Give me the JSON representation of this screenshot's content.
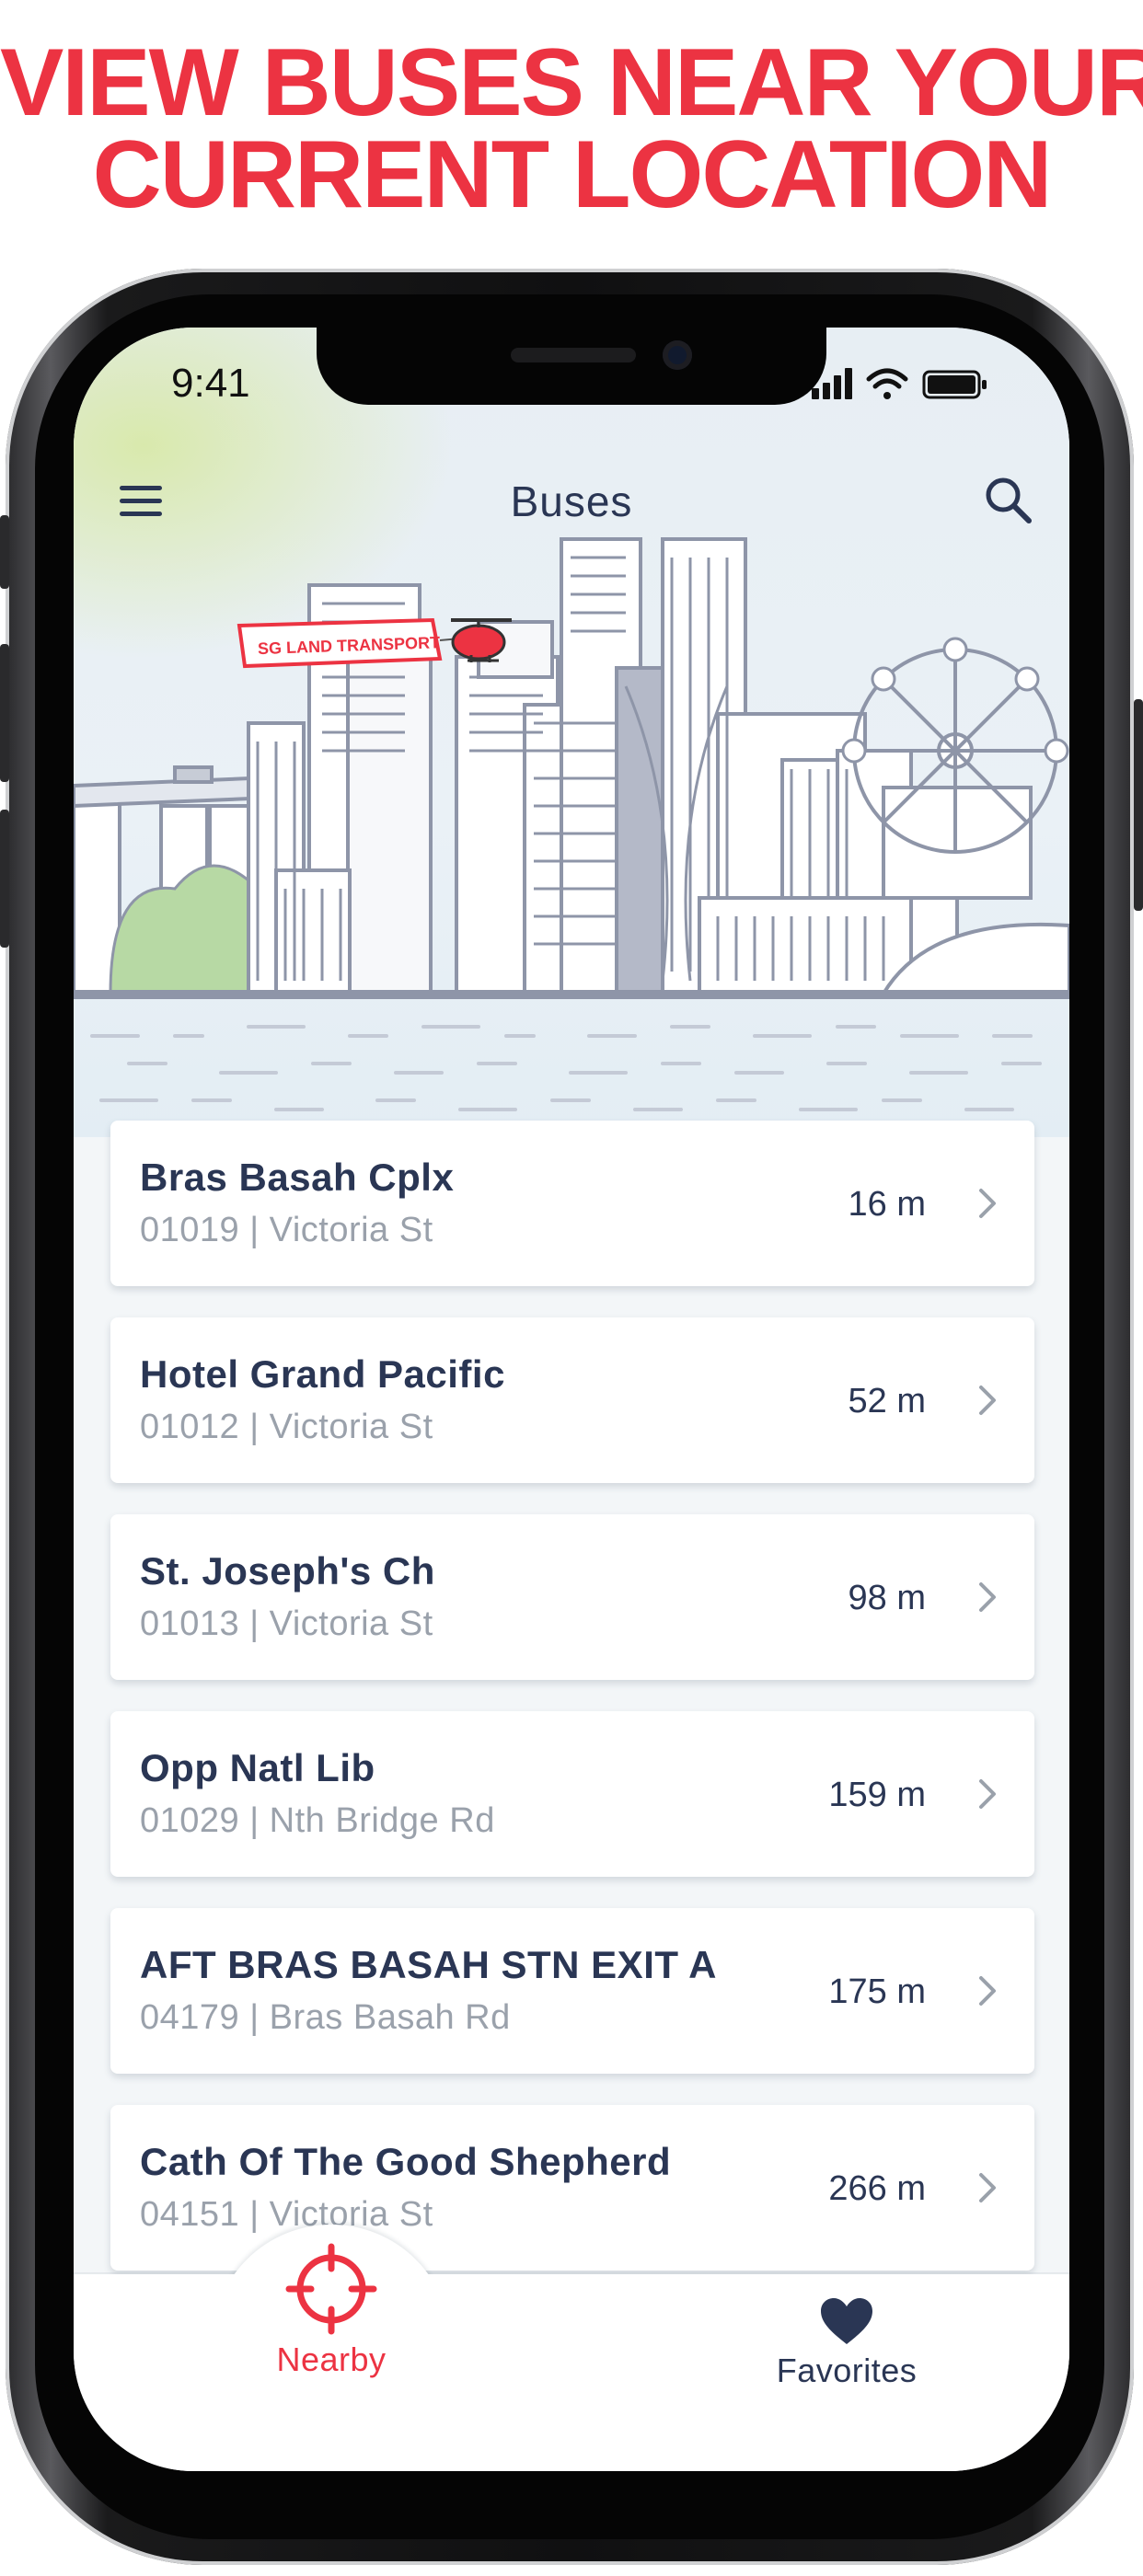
{
  "promo": {
    "line1": "VIEW BUSES NEAR YOUR",
    "line2": "CURRENT LOCATION"
  },
  "status_bar": {
    "time": "9:41"
  },
  "nav": {
    "title": "Buses",
    "menu_icon": "hamburger-menu-icon",
    "search_icon": "search-icon"
  },
  "hero": {
    "illustration": "singapore-skyline-illustration",
    "banner_text": "SG LAND TRANSPORT"
  },
  "bus_stops": [
    {
      "name": "Bras Basah Cplx",
      "code": "01019",
      "road": "Victoria St",
      "subtitle": "01019 | Victoria St",
      "distance": "16 m"
    },
    {
      "name": "Hotel Grand Pacific",
      "code": "01012",
      "road": "Victoria St",
      "subtitle": "01012 | Victoria St",
      "distance": "52 m"
    },
    {
      "name": "St. Joseph's Ch",
      "code": "01013",
      "road": "Victoria St",
      "subtitle": "01013 | Victoria St",
      "distance": "98 m"
    },
    {
      "name": "Opp Natl Lib",
      "code": "01029",
      "road": "Nth Bridge Rd",
      "subtitle": "01029 | Nth Bridge Rd",
      "distance": "159 m"
    },
    {
      "name": "AFT BRAS BASAH STN EXIT A",
      "code": "04179",
      "road": "Bras Basah Rd",
      "subtitle": "04179 | Bras Basah Rd",
      "distance": "175 m"
    },
    {
      "name": "Cath Of The Good Shepherd",
      "code": "04151",
      "road": "Victoria St",
      "subtitle": "04151 | Victoria St",
      "distance": "266 m"
    }
  ],
  "tabs": [
    {
      "label": "Nearby",
      "icon": "crosshair-location-icon",
      "active": true
    },
    {
      "label": "Favorites",
      "icon": "heart-icon",
      "active": false
    }
  ],
  "colors": {
    "accent": "#ec3342",
    "navy": "#2a3654",
    "muted": "#9aa1ab",
    "background": "#f3f6f8"
  }
}
